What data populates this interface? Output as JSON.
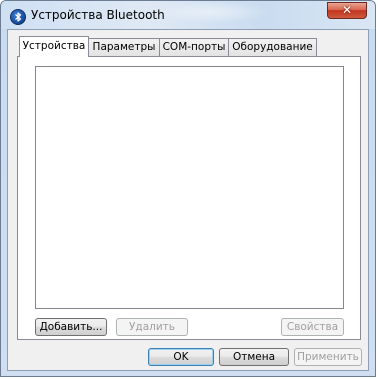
{
  "window": {
    "title": "Устройства Bluetooth",
    "close_symbol": "✕",
    "icon": "bluetooth-icon"
  },
  "tabs": [
    {
      "label": "Устройства",
      "active": true
    },
    {
      "label": "Параметры",
      "active": false
    },
    {
      "label": "COM-порты",
      "active": false
    },
    {
      "label": "Оборудование",
      "active": false
    }
  ],
  "devices_panel": {
    "add_label": "Добавить...",
    "remove_label": "Удалить",
    "properties_label": "Свойства"
  },
  "footer": {
    "ok_label": "OK",
    "cancel_label": "Отмена",
    "apply_label": "Применить"
  }
}
